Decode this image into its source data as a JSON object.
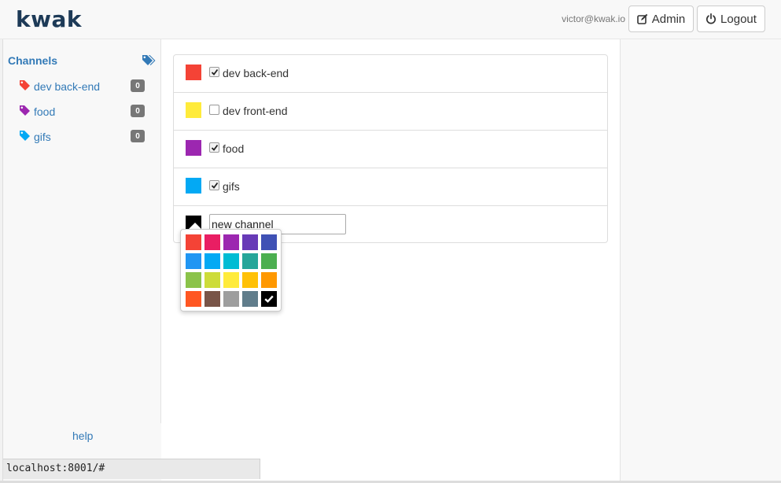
{
  "app": {
    "brand": "kwak",
    "user_email": "victor@kwak.io",
    "admin_label": "Admin",
    "logout_label": "Logout"
  },
  "sidebar": {
    "title": "Channels",
    "items": [
      {
        "label": "dev back-end",
        "color": "#f44336",
        "count": "0"
      },
      {
        "label": "food",
        "color": "#9c27b0",
        "count": "0"
      },
      {
        "label": "gifs",
        "color": "#03a9f4",
        "count": "0"
      }
    ],
    "help_label": "help"
  },
  "channels": [
    {
      "label": "dev back-end",
      "color": "#f44336",
      "checked": true
    },
    {
      "label": "dev front-end",
      "color": "#ffeb3b",
      "checked": false
    },
    {
      "label": "food",
      "color": "#9c27b0",
      "checked": true
    },
    {
      "label": "gifs",
      "color": "#03a9f4",
      "checked": true
    }
  ],
  "new_channel": {
    "value": "new channel",
    "color": "#000000"
  },
  "palette": {
    "colors": [
      "#f44336",
      "#e91e63",
      "#9c27b0",
      "#673ab7",
      "#3f51b5",
      "#2196f3",
      "#03a9f4",
      "#00bcd4",
      "#26a69a",
      "#4caf50",
      "#8bc34a",
      "#cddc39",
      "#ffeb3b",
      "#ffc107",
      "#ff9800",
      "#ff5722",
      "#795548",
      "#9e9e9e",
      "#607d8b",
      "#000000"
    ],
    "selected": "#000000"
  },
  "status_bar": {
    "url": "localhost:8001/#"
  }
}
